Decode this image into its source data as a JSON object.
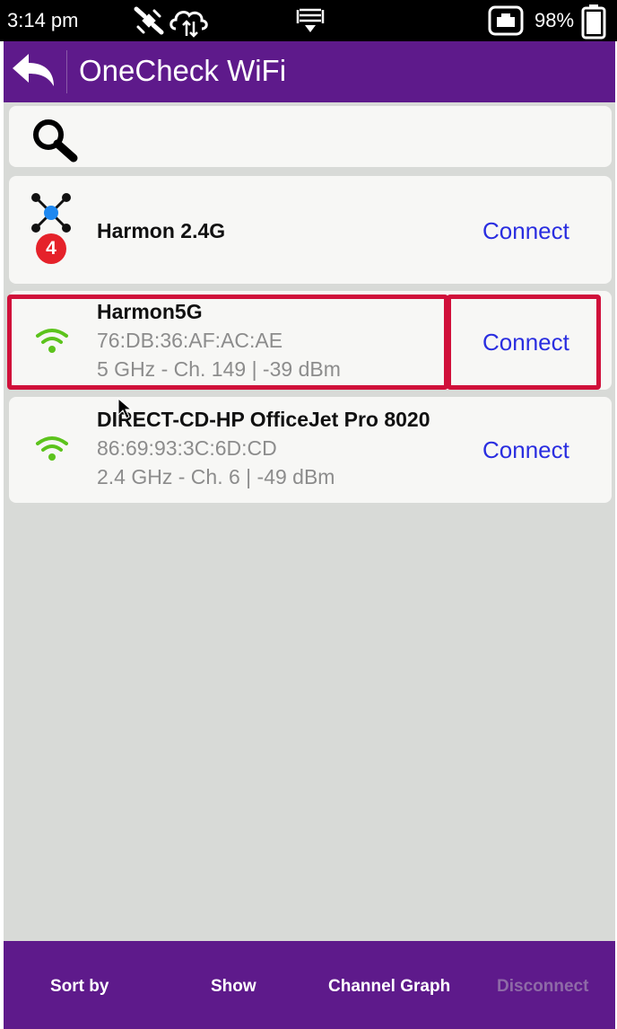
{
  "status_bar": {
    "time": "3:14 pm",
    "battery_percent": "98%",
    "icons": [
      "satellite-icon",
      "cloud-sync-icon",
      "tray-icon",
      "ethernet-icon",
      "battery-icon"
    ]
  },
  "app_bar": {
    "title": "OneCheck WiFi",
    "background": "#5e1a8b"
  },
  "search": {
    "icon": "search-icon"
  },
  "networks": [
    {
      "name": "Harmon 2.4G",
      "icon": "mesh-network-icon",
      "badge": "4",
      "action": "Connect"
    },
    {
      "name": "Harmon5G",
      "mac": "76:DB:36:AF:AC:AE",
      "details": "5 GHz - Ch. 149 | -39 dBm",
      "icon": "wifi-signal-icon",
      "action": "Connect",
      "highlighted": true
    },
    {
      "name": "DIRECT-CD-HP OfficeJet Pro 8020",
      "mac": "86:69:93:3C:6D:CD",
      "details": "2.4 GHz - Ch. 6 | -49 dBm",
      "icon": "wifi-signal-icon",
      "action": "Connect"
    }
  ],
  "bottom_bar": {
    "sort_by": "Sort by",
    "show": "Show",
    "channel_graph": "Channel Graph",
    "disconnect": "Disconnect"
  },
  "colors": {
    "accent": "#5e1a8b",
    "link": "#2a2ee0",
    "highlight": "#d0103a",
    "wifi_green": "#5cc31c"
  }
}
